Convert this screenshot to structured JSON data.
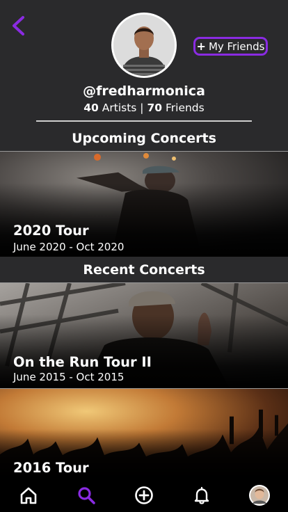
{
  "profile": {
    "username": "@fredharmonica",
    "artists_count": "40",
    "artists_label": "Artists",
    "separator": "|",
    "friends_count": "70",
    "friends_label": "Friends",
    "friends_button_plus": "+",
    "friends_button_label": "My Friends"
  },
  "sections": {
    "upcoming": "Upcoming Concerts",
    "recent": "Recent Concerts"
  },
  "concerts": {
    "upcoming": [
      {
        "title": "2020 Tour",
        "dates": "June 2020 - Oct 2020"
      }
    ],
    "recent": [
      {
        "title": "On the Run Tour II",
        "dates": "June 2015 - Oct 2015"
      },
      {
        "title": "2016 Tour",
        "dates": ""
      }
    ]
  },
  "tabbar": {
    "items": [
      {
        "icon": "home-icon",
        "active": false
      },
      {
        "icon": "search-icon",
        "active": true
      },
      {
        "icon": "add-icon",
        "active": false
      },
      {
        "icon": "bell-icon",
        "active": false
      },
      {
        "icon": "profile-avatar",
        "active": false
      }
    ]
  },
  "colors": {
    "accent": "#8a2be2",
    "background": "#2a2a2c",
    "tabbar": "#000000"
  }
}
